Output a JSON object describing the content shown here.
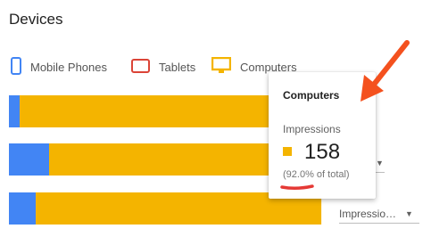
{
  "header": {
    "title": "Devices"
  },
  "legend": [
    {
      "label": "Mobile Phones",
      "icon": "phone-icon",
      "color": "#4285f4"
    },
    {
      "label": "Tablets",
      "icon": "tablet-icon",
      "color": "#db4437"
    },
    {
      "label": "Computers",
      "icon": "computer-icon",
      "color": "#f4b400"
    }
  ],
  "bars": [
    {
      "segments": [
        {
          "device": "Mobile Phones",
          "share": 0.033
        },
        {
          "device": "Tablets",
          "share": 0.0
        },
        {
          "device": "Computers",
          "share": 0.967
        }
      ]
    },
    {
      "segments": [
        {
          "device": "Mobile Phones",
          "share": 0.129
        },
        {
          "device": "Tablets",
          "share": 0.0
        },
        {
          "device": "Computers",
          "share": 0.871
        }
      ]
    },
    {
      "segments": [
        {
          "device": "Mobile Phones",
          "share": 0.086
        },
        {
          "device": "Tablets",
          "share": 0.0
        },
        {
          "device": "Computers",
          "share": 0.914
        }
      ]
    }
  ],
  "metric_dropdown": {
    "label": "Impressio…"
  },
  "tooltip": {
    "title": "Computers",
    "metric": "Impressions",
    "value": "158",
    "share_text": "(92.0% of total)",
    "swatch_color": "#f4b400"
  },
  "annotation": {
    "arrow_color": "#f4511e",
    "underline_color": "#e53935"
  }
}
